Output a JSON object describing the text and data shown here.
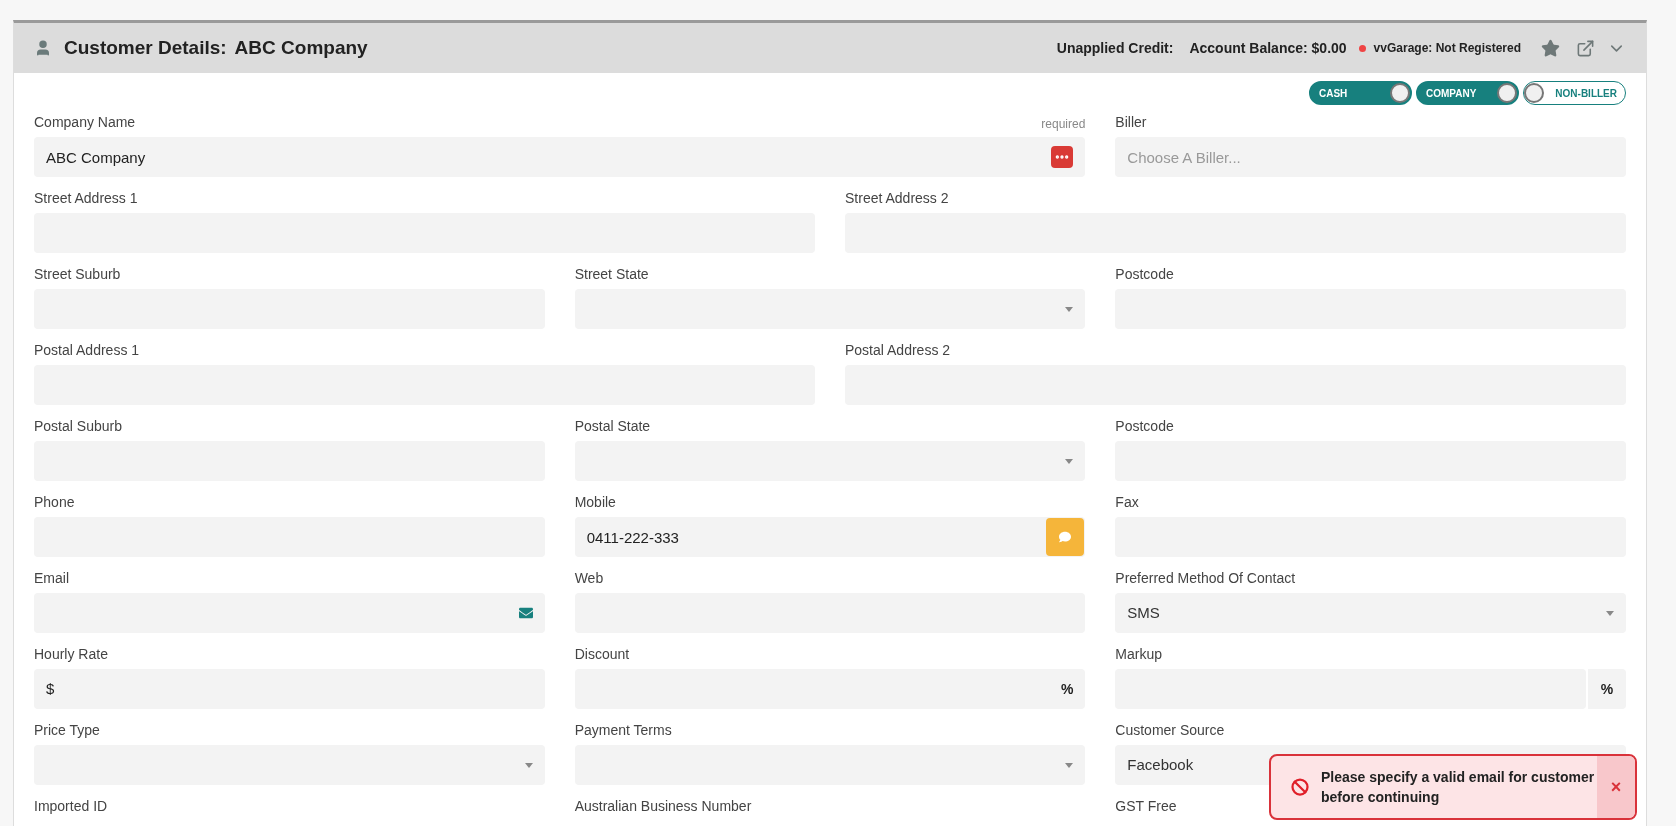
{
  "header": {
    "title": "Customer Details:",
    "customer": "ABC Company",
    "unapplied_credit": "Unapplied Credit:",
    "account_balance": "Account Balance: $0.00",
    "status_dot": {
      "color": "#ef4444"
    },
    "registration": "vvGarage: Not Registered"
  },
  "toggles": [
    {
      "label": "CASH",
      "on": true
    },
    {
      "label": "COMPANY",
      "on": true
    },
    {
      "label": "NON-BILLER",
      "on": false
    }
  ],
  "rows": [
    {
      "kind": "wide-first",
      "fields": [
        {
          "label": "Company Name",
          "hint": "required",
          "kind": "text",
          "value": "ABC Company",
          "addon": {
            "kind": "menu-button"
          }
        },
        {
          "label": "Biller",
          "kind": "text",
          "placeholder": "Choose A Biller..."
        }
      ]
    },
    {
      "kind": "halves",
      "fields": [
        {
          "label": "Street Address 1",
          "kind": "text"
        },
        {
          "label": "Street Address 2",
          "kind": "text"
        }
      ]
    },
    {
      "kind": "thirds",
      "fields": [
        {
          "label": "Street Suburb",
          "kind": "text"
        },
        {
          "label": "Street State",
          "kind": "select"
        },
        {
          "label": "Postcode",
          "kind": "text"
        }
      ]
    },
    {
      "kind": "halves",
      "fields": [
        {
          "label": "Postal Address 1",
          "kind": "text"
        },
        {
          "label": "Postal Address 2",
          "kind": "text"
        }
      ]
    },
    {
      "kind": "thirds",
      "fields": [
        {
          "label": "Postal Suburb",
          "kind": "text"
        },
        {
          "label": "Postal State",
          "kind": "select"
        },
        {
          "label": "Postcode",
          "kind": "text"
        }
      ]
    },
    {
      "kind": "thirds",
      "fields": [
        {
          "label": "Phone",
          "kind": "text"
        },
        {
          "label": "Mobile",
          "kind": "text",
          "value": "0411-222-333",
          "addon": {
            "kind": "sms-button"
          }
        },
        {
          "label": "Fax",
          "kind": "text"
        }
      ]
    },
    {
      "kind": "thirds",
      "fields": [
        {
          "label": "Email",
          "kind": "text",
          "addon": {
            "kind": "email-icon"
          }
        },
        {
          "label": "Web",
          "kind": "text"
        },
        {
          "label": "Preferred Method Of Contact",
          "kind": "select",
          "value": "SMS"
        }
      ]
    },
    {
      "kind": "thirds",
      "fields": [
        {
          "label": "Hourly Rate",
          "kind": "text",
          "addon": {
            "kind": "prefix",
            "text": "$"
          }
        },
        {
          "label": "Discount",
          "kind": "text",
          "addon": {
            "kind": "suffix",
            "text": "%"
          }
        },
        {
          "label": "Markup",
          "kind": "text",
          "addon": {
            "kind": "suffix-box",
            "text": "%"
          }
        }
      ]
    },
    {
      "kind": "thirds",
      "fields": [
        {
          "label": "Price Type",
          "kind": "select"
        },
        {
          "label": "Payment Terms",
          "kind": "select"
        },
        {
          "label": "Customer Source",
          "kind": "select",
          "value": "Facebook"
        }
      ]
    },
    {
      "kind": "thirds",
      "fields": [
        {
          "label": "Imported ID",
          "kind": "label"
        },
        {
          "label": "Australian Business Number",
          "kind": "label"
        },
        {
          "label": "GST Free",
          "kind": "label"
        }
      ]
    }
  ],
  "toast": {
    "message": "Please specify a valid email for customer before continuing",
    "close": "×"
  }
}
